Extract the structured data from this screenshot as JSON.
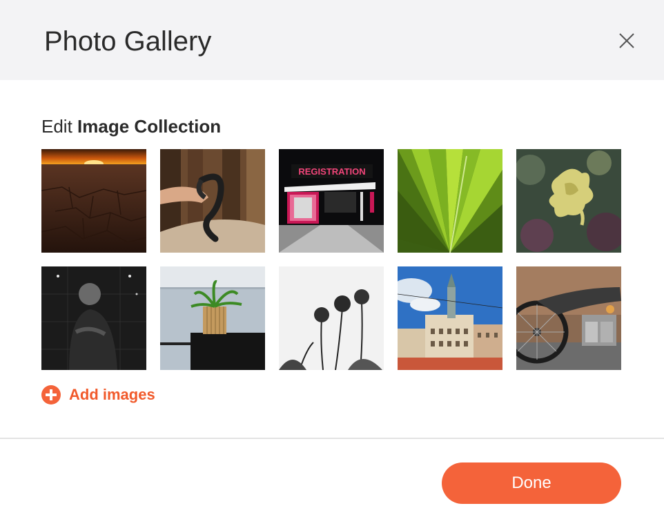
{
  "header": {
    "title": "Photo Gallery",
    "close_icon": "close-icon"
  },
  "section": {
    "title_prefix": "Edit",
    "title_bold": "Image Collection"
  },
  "images": [
    {
      "subject": "desert-sunset"
    },
    {
      "subject": "hand-holding-snake"
    },
    {
      "subject": "registration-building-night",
      "sign_text": "REGISTRATION"
    },
    {
      "subject": "green-palm-leaf"
    },
    {
      "subject": "seaweed-on-rocks"
    },
    {
      "subject": "man-in-dark-room"
    },
    {
      "subject": "plant-on-balcony-by-sea"
    },
    {
      "subject": "allium-flowers-bw"
    },
    {
      "subject": "city-building-blue-sky"
    },
    {
      "subject": "vintage-motorcycle"
    }
  ],
  "actions": {
    "add_images_label": "Add images",
    "add_icon": "plus-circle-icon",
    "done_label": "Done"
  },
  "colors": {
    "accent": "#f4633a",
    "header_bg": "#f3f3f5",
    "text": "#2a2a2a"
  }
}
